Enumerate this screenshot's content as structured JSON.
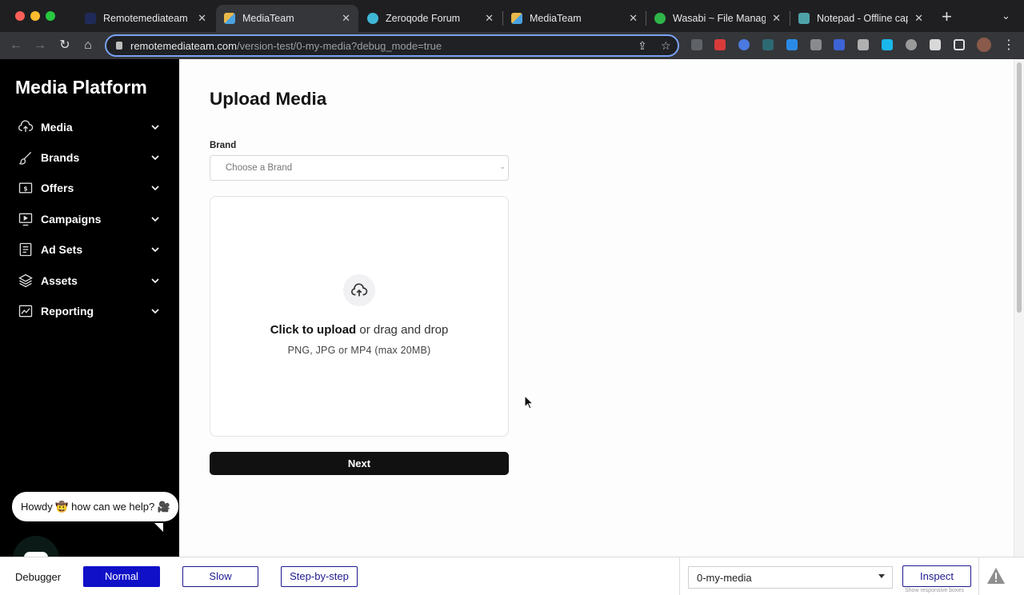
{
  "browser": {
    "tabs": [
      {
        "title": "Remotemediateam | Bu",
        "favicon_color": "#1f2a5a",
        "active": false
      },
      {
        "title": "MediaTeam",
        "favicon_color": "#e9b84a",
        "active": true
      },
      {
        "title": "Zeroqode Forum",
        "favicon_color": "#3fb8d6",
        "active": false
      },
      {
        "title": "MediaTeam",
        "favicon_color": "#e9b84a",
        "active": false
      },
      {
        "title": "Wasabi ~ File Manager",
        "favicon_color": "#2fb54a",
        "active": false
      },
      {
        "title": "Notepad - Offline capa",
        "favicon_color": "#4fa3a8",
        "active": false
      }
    ],
    "url_domain": "remotemediateam.com",
    "url_path": "/version-test/0-my-media?debug_mode=true"
  },
  "sidebar": {
    "brand": "Media Platform",
    "items": [
      {
        "label": "Media",
        "icon": "cloud-upload-icon"
      },
      {
        "label": "Brands",
        "icon": "brush-icon"
      },
      {
        "label": "Offers",
        "icon": "dollar-bill-icon"
      },
      {
        "label": "Campaigns",
        "icon": "play-screen-icon"
      },
      {
        "label": "Ad Sets",
        "icon": "document-list-icon"
      },
      {
        "label": "Assets",
        "icon": "layers-icon"
      },
      {
        "label": "Reporting",
        "icon": "chart-line-icon"
      }
    ]
  },
  "chat": {
    "greeting": "Howdy 🤠 how can we help? 🎥"
  },
  "main": {
    "title": "Upload Media",
    "brand_label": "Brand",
    "brand_placeholder": "Choose a Brand",
    "upload_cta": "Click to upload",
    "upload_rest": "or drag and drop",
    "upload_hint": "PNG, JPG or MP4 (max 20MB)",
    "next_label": "Next"
  },
  "debugger": {
    "label": "Debugger",
    "modes": [
      "Normal",
      "Slow",
      "Step-by-step"
    ],
    "active_mode": "Normal",
    "page": "0-my-media",
    "inspect_label": "Inspect",
    "responsive_note": "Show responsive boxes"
  },
  "colors": {
    "sidebar_bg": "#000000",
    "primary_button": "#111111",
    "debugger_active": "#1010c8"
  }
}
